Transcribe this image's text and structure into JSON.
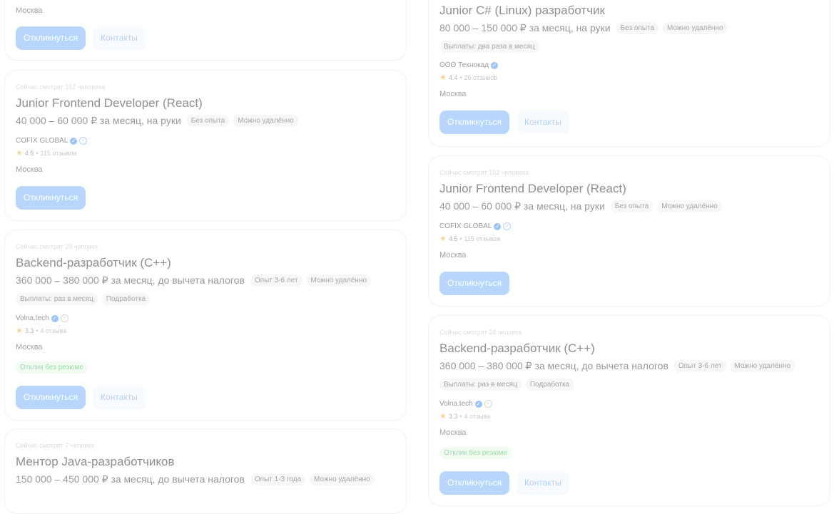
{
  "left_column": {
    "card1": {
      "city": "Москва",
      "apply_label": "Откликнуться",
      "contacts_label": "Контакты"
    },
    "card2": {
      "watching": "Сейчас смотрят 152 человека",
      "title": "Junior Frontend Developer (React)",
      "salary": "40 000 – 60 000 ₽ за месяц, на руки",
      "tags": [
        "Без опыта",
        "Можно удалённо"
      ],
      "company": "COFIX GLOBAL",
      "rating": "4.5",
      "reviews": "115 отзывов",
      "city": "Москва",
      "apply_label": "Откликнуться"
    },
    "card3": {
      "watching": "Сейчас смотрят 28 человек",
      "title": "Backend-разработчик (C++)",
      "salary": "360 000 – 380 000 ₽ за месяц, до вычета налогов",
      "tags": [
        "Опыт 3-6 лет",
        "Можно удалённо"
      ],
      "tags2": [
        "Выплаты: раз в месяц",
        "Подработка"
      ],
      "company": "Volna.tech",
      "rating": "3.3",
      "reviews": "4 отзыва",
      "city": "Москва",
      "no_resume": "Отклик без резюме",
      "apply_label": "Откликнуться",
      "contacts_label": "Контакты"
    },
    "card4": {
      "watching": "Сейчас смотрят 7 человек",
      "title": "Ментор Java-разработчиков",
      "salary": "150 000 – 450 000 ₽ за месяц, до вычета налогов",
      "tags": [
        "Опыт 1-3 года",
        "Можно удалённо"
      ]
    }
  },
  "right_column": {
    "card1": {
      "title": "Junior C# (Linux) разработчик",
      "salary": "80 000 – 150 000 ₽ за месяц, на руки",
      "tags": [
        "Без опыта",
        "Можно удалённо"
      ],
      "tags2": [
        "Выплаты: два раза в месяц"
      ],
      "company": "ООО Технокад",
      "rating": "4.4",
      "reviews": "26 отзывов",
      "city": "Москва",
      "apply_label": "Откликнуться",
      "contacts_label": "Контакты"
    },
    "card2": {
      "watching": "Сейчас смотрят 152 человека",
      "title": "Junior Frontend Developer (React)",
      "salary": "40 000 – 60 000 ₽ за месяц, на руки",
      "tags": [
        "Без опыта",
        "Можно удалённо"
      ],
      "company": "COFIX GLOBAL",
      "rating": "4.5",
      "reviews": "115 отзывов",
      "city": "Москва",
      "apply_label": "Откликнуться"
    },
    "card3": {
      "watching": "Сейчас смотрят 28 человек",
      "title": "Backend-разработчик (C++)",
      "salary": "360 000 – 380 000 ₽ за месяц, до вычета налогов",
      "tags": [
        "Опыт 3-6 лет",
        "Можно удалённо"
      ],
      "tags2": [
        "Выплаты: раз в месяц",
        "Подработка"
      ],
      "company": "Volna.tech",
      "rating": "3.3",
      "reviews": "4 отзыва",
      "city": "Москва",
      "no_resume": "Отклик без резюме",
      "apply_label": "Откликнуться",
      "contacts_label": "Контакты"
    }
  },
  "icons": {
    "verified": "verified-check-icon",
    "star": "star-icon"
  },
  "colors": {
    "primary_button": "#b8d6fc",
    "secondary_button_text": "#b3d1f5",
    "verified": "#9cc4f8",
    "star": "#f7d49a",
    "no_resume_text": "#9edcaa"
  }
}
